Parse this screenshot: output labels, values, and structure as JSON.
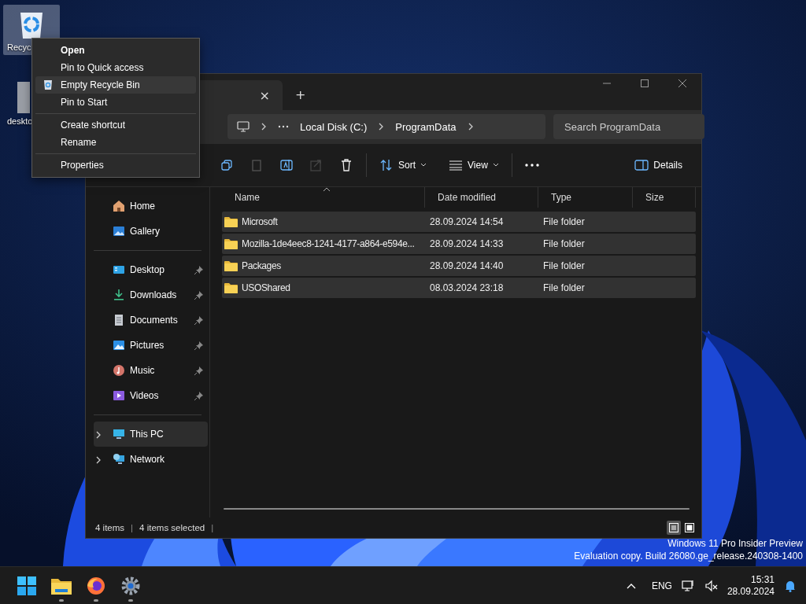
{
  "desktop_icons": [
    {
      "kind": "recycle-bin",
      "label": "Recyc",
      "selected": true
    },
    {
      "kind": "blank",
      "label": "deskto",
      "selected": false
    }
  ],
  "explorer": {
    "tab_close": "×",
    "new_tab": "+",
    "address": {
      "path": [
        "Local Disk (C:)",
        "ProgramData"
      ]
    },
    "search": {
      "placeholder": "Search ProgramData"
    },
    "commands": {
      "sort": "Sort",
      "view": "View",
      "details": "Details"
    },
    "sidebar": {
      "groups": [
        [
          {
            "label": "Home",
            "kind": "home",
            "pinned": false,
            "selected": false,
            "expandable": false
          },
          {
            "label": "Gallery",
            "kind": "gallery",
            "pinned": false,
            "selected": false,
            "expandable": false
          }
        ],
        [
          {
            "label": "Desktop",
            "kind": "desktop",
            "pinned": true,
            "selected": false,
            "expandable": false
          },
          {
            "label": "Downloads",
            "kind": "downloads",
            "pinned": true,
            "selected": false,
            "expandable": false
          },
          {
            "label": "Documents",
            "kind": "documents",
            "pinned": true,
            "selected": false,
            "expandable": false
          },
          {
            "label": "Pictures",
            "kind": "pictures",
            "pinned": true,
            "selected": false,
            "expandable": false
          },
          {
            "label": "Music",
            "kind": "music",
            "pinned": true,
            "selected": false,
            "expandable": false
          },
          {
            "label": "Videos",
            "kind": "videos",
            "pinned": true,
            "selected": false,
            "expandable": false
          }
        ],
        [
          {
            "label": "This PC",
            "kind": "pc",
            "pinned": false,
            "selected": true,
            "expandable": true
          },
          {
            "label": "Network",
            "kind": "network",
            "pinned": false,
            "selected": false,
            "expandable": true
          }
        ]
      ]
    },
    "columns": [
      "Name",
      "Date modified",
      "Type",
      "Size"
    ],
    "rows": [
      {
        "name": "Microsoft",
        "date": "28.09.2024 14:54",
        "type": "File folder",
        "selected": true
      },
      {
        "name": "Mozilla-1de4eec8-1241-4177-a864-e594e...",
        "date": "28.09.2024 14:33",
        "type": "File folder",
        "selected": true
      },
      {
        "name": "Packages",
        "date": "28.09.2024 14:40",
        "type": "File folder",
        "selected": true
      },
      {
        "name": "USOShared",
        "date": "08.03.2024 23:18",
        "type": "File folder",
        "selected": true
      }
    ],
    "status": [
      {
        "kind": "count",
        "text": "4 items"
      },
      {
        "kind": "divider",
        "text": "|"
      },
      {
        "kind": "selection",
        "text": "4 items selected"
      },
      {
        "kind": "divider",
        "text": "|"
      }
    ],
    "view_modes": [
      {
        "kind": "details",
        "selected": true
      },
      {
        "kind": "tiles",
        "selected": false
      }
    ]
  },
  "context_menu": {
    "groups": [
      [
        {
          "label": "Open",
          "default": true,
          "hovered": false,
          "icon": false
        },
        {
          "label": "Pin to Quick access",
          "default": false,
          "hovered": false,
          "icon": false
        },
        {
          "label": "Empty Recycle Bin",
          "default": false,
          "hovered": true,
          "icon": true
        },
        {
          "label": "Pin to Start",
          "default": false,
          "hovered": false,
          "icon": false
        }
      ],
      [
        {
          "label": "Create shortcut",
          "default": false,
          "hovered": false,
          "icon": false
        },
        {
          "label": "Rename",
          "default": false,
          "hovered": false,
          "icon": false
        }
      ],
      [
        {
          "label": "Properties",
          "default": false,
          "hovered": false,
          "icon": false
        }
      ]
    ]
  },
  "evaluation_notice": [
    "Windows 11 Pro Insider Preview",
    "Evaluation copy. Build 26080.ge_release.240308-1400"
  ],
  "taskbar": {
    "apps": [
      {
        "kind": "start",
        "running": false
      },
      {
        "kind": "explorer",
        "running": true
      },
      {
        "kind": "firefox",
        "running": true
      },
      {
        "kind": "settings",
        "running": true
      }
    ],
    "tray": {
      "language": "ENG",
      "time": "15:31",
      "date": "28.09.2024"
    }
  }
}
